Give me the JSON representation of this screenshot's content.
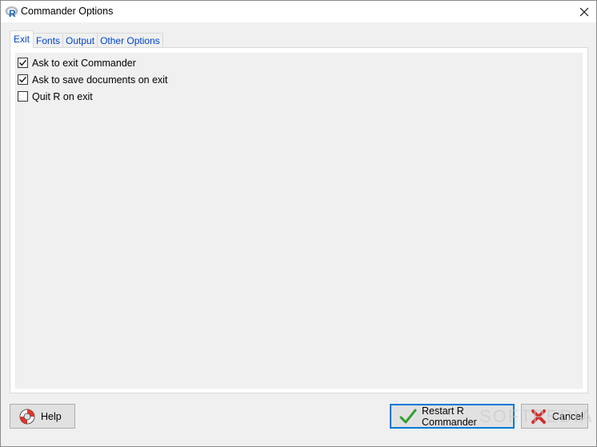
{
  "window": {
    "title": "Commander Options",
    "icon": "r-logo-icon",
    "close_glyph": "✕"
  },
  "tabs": [
    {
      "label": "Exit",
      "active": true
    },
    {
      "label": "Fonts",
      "active": false
    },
    {
      "label": "Output",
      "active": false
    },
    {
      "label": "Other Options",
      "active": false
    }
  ],
  "options": [
    {
      "label": "Ask to exit Commander",
      "checked": true
    },
    {
      "label": "Ask to save documents on exit",
      "checked": true
    },
    {
      "label": "Quit R on exit",
      "checked": false
    }
  ],
  "buttons": {
    "help_label": "Help",
    "restart_label": "Restart R Commander",
    "cancel_label": "Cancel"
  },
  "colors": {
    "accent": "#0078d7",
    "tab_text": "#0044cc"
  },
  "watermark": "SOFTPEDIA"
}
